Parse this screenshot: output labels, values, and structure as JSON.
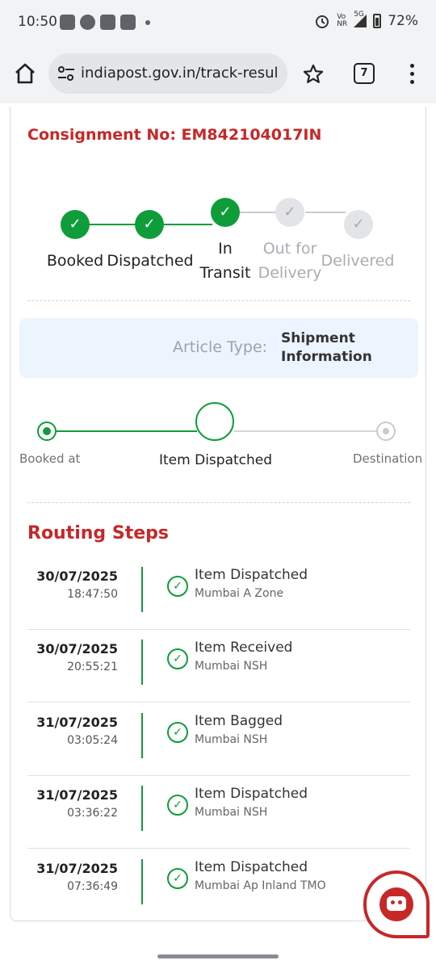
{
  "status_bar": {
    "time": "10:50",
    "battery": "72%",
    "net_top": "Vo",
    "net_bottom": "NR",
    "net_5g": "5G"
  },
  "browser": {
    "url": "indiapost.gov.in/track-resul",
    "tab_count": "7"
  },
  "consignment": {
    "label": "Consignment No: EM842104017IN"
  },
  "progress": {
    "steps": [
      {
        "line1": "Booked",
        "line2": "",
        "state": "done"
      },
      {
        "line1": "Dispatched",
        "line2": "",
        "state": "done"
      },
      {
        "line1": "In",
        "line2": "Transit",
        "state": "done"
      },
      {
        "line1": "Out for",
        "line2": "Delivery",
        "state": "pending"
      },
      {
        "line1": "Delivered",
        "line2": "",
        "state": "pending"
      }
    ]
  },
  "article": {
    "label": "Article Type:",
    "value_line1": "Shipment",
    "value_line2": "Information"
  },
  "journey": {
    "start": "Booked at",
    "current": "Item Dispatched",
    "end": "Destination"
  },
  "routing": {
    "title": "Routing Steps",
    "rows": [
      {
        "date": "30/07/2025",
        "time": "18:47:50",
        "event": "Item Dispatched",
        "office": "Mumbai A Zone"
      },
      {
        "date": "30/07/2025",
        "time": "20:55:21",
        "event": "Item Received",
        "office": "Mumbai NSH"
      },
      {
        "date": "31/07/2025",
        "time": "03:05:24",
        "event": "Item Bagged",
        "office": "Mumbai NSH"
      },
      {
        "date": "31/07/2025",
        "time": "03:36:22",
        "event": "Item Dispatched",
        "office": "Mumbai NSH"
      },
      {
        "date": "31/07/2025",
        "time": "07:36:49",
        "event": "Item Dispatched",
        "office": "Mumbai Ap Inland TMO"
      }
    ]
  },
  "colors": {
    "accent_red": "#c62828",
    "success_green": "#0f9d3a",
    "pending_gray": "#e3e4e8"
  },
  "icons": {
    "check": "✓"
  }
}
